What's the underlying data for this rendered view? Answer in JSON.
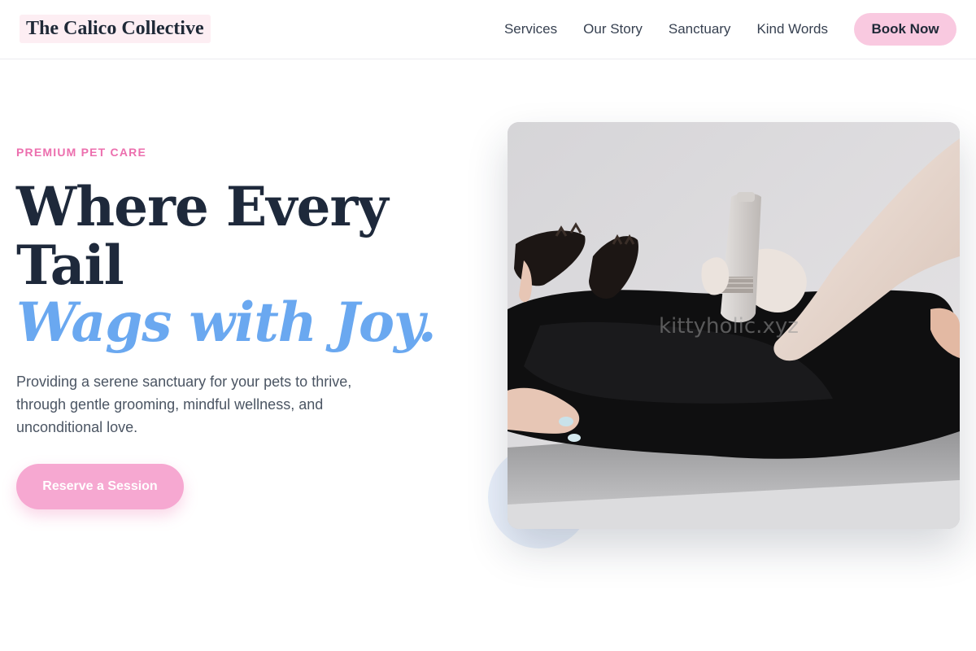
{
  "header": {
    "brand": "The Calico Collective",
    "nav": [
      {
        "label": "Services"
      },
      {
        "label": "Our Story"
      },
      {
        "label": "Sanctuary"
      },
      {
        "label": "Kind Words"
      }
    ],
    "cta_label": "Book Now"
  },
  "hero": {
    "eyebrow": "PREMIUM PET CARE",
    "headline_line1": "Where Every",
    "headline_line2": "Tail",
    "headline_accent": "Wags with Joy.",
    "description": "Providing a serene sanctuary for your pets to thrive, through gentle grooming, mindful wellness, and unconditional love.",
    "cta_label": "Reserve a Session",
    "image_watermark": "kittyholic.xyz"
  },
  "colors": {
    "accent_pink": "#f6a8d1",
    "eyebrow_pink": "#ec6fae",
    "accent_blue": "#6aa8f0",
    "heading_dark": "#1e293b",
    "brand_highlight": "#fdeef3"
  },
  "icons": {
    "hero_photo": "pet-care-photo-dog-ultrasound"
  }
}
